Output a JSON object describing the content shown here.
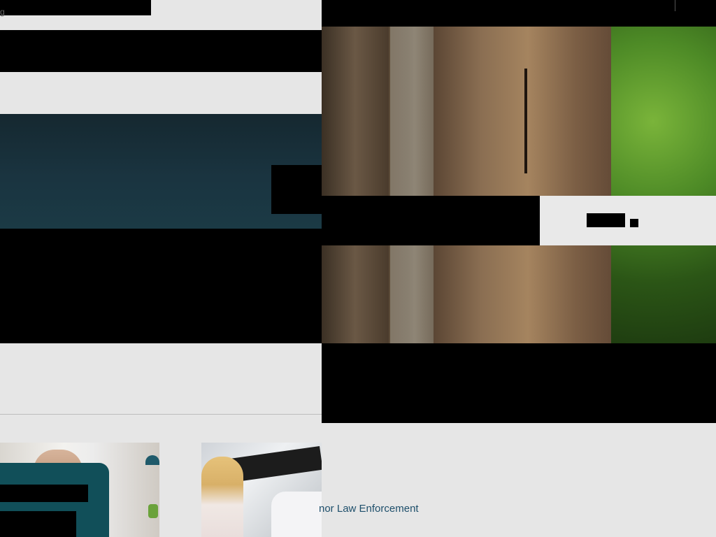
{
  "header": {
    "top_left_text": "g"
  },
  "cards": {
    "caption": "nor Law Enforcement"
  },
  "images": {
    "hero": "forest-trunks-photo",
    "left_band": "dark-water-photo",
    "card_1": "person-at-home-photo",
    "card_2": "child-with-keyboard-photo"
  }
}
